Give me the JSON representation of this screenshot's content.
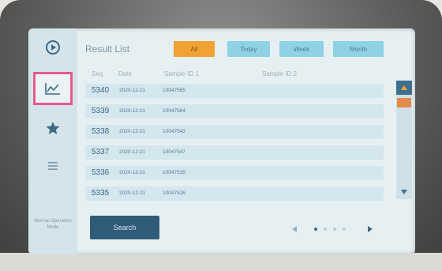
{
  "header": {
    "title": "Result List"
  },
  "filters": [
    {
      "label": "All",
      "active": true
    },
    {
      "label": "Today",
      "active": false
    },
    {
      "label": "Week",
      "active": false
    },
    {
      "label": "Month",
      "active": false
    }
  ],
  "columns": {
    "seq": "Seq",
    "date": "Date",
    "sample_id_1": "Sample ID 1",
    "sample_id_2": "Sample ID 2"
  },
  "rows": [
    {
      "seq": "5340",
      "date": "2020-12-21",
      "sample_id_1": "10047565",
      "sample_id_2": ""
    },
    {
      "seq": "5339",
      "date": "2020-12-21",
      "sample_id_1": "10047564",
      "sample_id_2": ""
    },
    {
      "seq": "5338",
      "date": "2020-12-21",
      "sample_id_1": "10047543",
      "sample_id_2": ""
    },
    {
      "seq": "5337",
      "date": "2020-12-21",
      "sample_id_1": "10047547",
      "sample_id_2": ""
    },
    {
      "seq": "5336",
      "date": "2020-12-21",
      "sample_id_1": "10047535",
      "sample_id_2": ""
    },
    {
      "seq": "5335",
      "date": "2020-12-21",
      "sample_id_1": "10047526",
      "sample_id_2": ""
    }
  ],
  "sidebar": {
    "items": [
      {
        "icon": "play-icon"
      },
      {
        "icon": "chart-line-icon",
        "active": true
      },
      {
        "icon": "star-icon"
      },
      {
        "icon": "menu-icon"
      }
    ],
    "footer": "Normal Operation Mode"
  },
  "search": {
    "label": "Search"
  },
  "colors": {
    "accent_active": "#f0a235",
    "filter_inactive": "#8fd2e6",
    "highlight": "#e85a8e",
    "button_dark": "#2f5c78"
  }
}
